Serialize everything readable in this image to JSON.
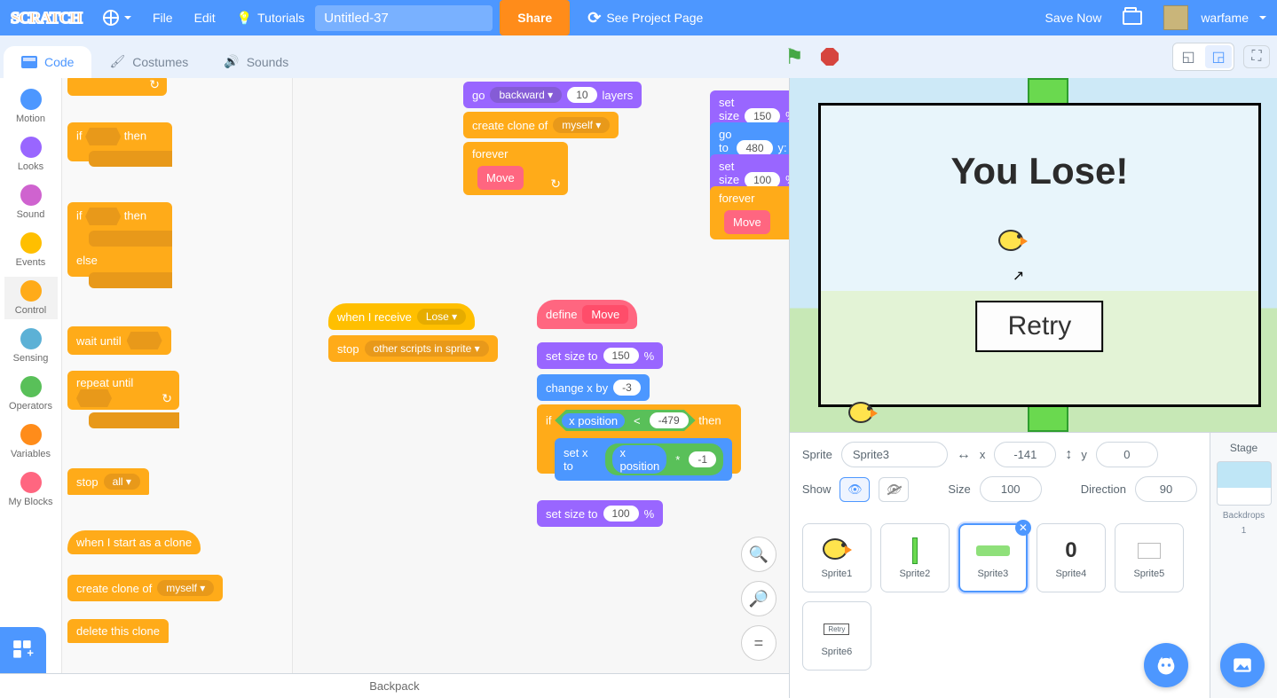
{
  "menubar": {
    "logo_text": "SCRATCH",
    "file": "File",
    "edit": "Edit",
    "tutorials": "Tutorials",
    "project_title": "Untitled-37",
    "share": "Share",
    "see_project": "See Project Page",
    "save_now": "Save Now",
    "username": "warfame"
  },
  "tabs": {
    "code": "Code",
    "costumes": "Costumes",
    "sounds": "Sounds"
  },
  "categories": [
    {
      "name": "Motion",
      "color": "#4c97ff"
    },
    {
      "name": "Looks",
      "color": "#9966ff"
    },
    {
      "name": "Sound",
      "color": "#cf63cf"
    },
    {
      "name": "Events",
      "color": "#ffbf00"
    },
    {
      "name": "Control",
      "color": "#ffab19"
    },
    {
      "name": "Sensing",
      "color": "#5cb1d6"
    },
    {
      "name": "Operators",
      "color": "#59c059"
    },
    {
      "name": "Variables",
      "color": "#ff8c1a"
    },
    {
      "name": "My Blocks",
      "color": "#ff6680"
    }
  ],
  "palette_blocks": {
    "if_then": "if            then",
    "else": "else",
    "wait_until": "wait until",
    "repeat_until": "repeat until",
    "stop": "stop",
    "stop_opt": "all ▾",
    "clone_start": "when I start as a clone",
    "create_clone": "create clone of",
    "create_clone_opt": "myself ▾",
    "delete_clone": "delete this clone"
  },
  "canvas_blocks": {
    "go_layers": {
      "go": "go",
      "dir": "backward ▾",
      "n": "10",
      "layers": "layers"
    },
    "create_clone": {
      "label": "create clone of",
      "opt": "myself ▾"
    },
    "forever": "forever",
    "move": "Move",
    "when_receive": {
      "label": "when I receive",
      "opt": "Lose ▾"
    },
    "stop_scripts": {
      "label": "stop",
      "opt": "other scripts in sprite ▾"
    },
    "define": "define",
    "set_size_150": {
      "label": "set size to",
      "val": "150",
      "pct": "%"
    },
    "change_x": {
      "label": "change x by",
      "val": "-3"
    },
    "if_then": "if",
    "then": "then",
    "xpos": "x position",
    "lt": "<",
    "cmp": "-479",
    "set_x": {
      "label": "set x to"
    },
    "times": "*",
    "neg1": "-1",
    "set_size_100": {
      "label": "set size to",
      "val": "100",
      "pct": "%"
    },
    "right_stack": {
      "set_size150": {
        "label": "set size to",
        "val": "150",
        "pct": "%"
      },
      "gotoxy": {
        "label": "go to x:",
        "x": "480",
        "y": "y:"
      },
      "set_size100": {
        "label": "set size to",
        "val": "100",
        "pct": "%"
      },
      "forever": "forever",
      "move": "Move"
    }
  },
  "zoom": {
    "in": "+",
    "out": "−",
    "eq": "="
  },
  "backpack": "Backpack",
  "stage": {
    "lose": "You Lose!",
    "retry": "Retry"
  },
  "sprite_info": {
    "sprite_label": "Sprite",
    "sprite_name": "Sprite3",
    "x_label": "x",
    "x": "-141",
    "y_label": "y",
    "y": "0",
    "show_label": "Show",
    "size_label": "Size",
    "size": "100",
    "dir_label": "Direction",
    "dir": "90"
  },
  "sprites": [
    {
      "name": "Sprite1",
      "thumb": "bird"
    },
    {
      "name": "Sprite2",
      "thumb": "pipe"
    },
    {
      "name": "Sprite3",
      "thumb": "ground",
      "selected": true
    },
    {
      "name": "Sprite4",
      "thumb": "zero"
    },
    {
      "name": "Sprite5",
      "thumb": "blank"
    },
    {
      "name": "Sprite6",
      "thumb": "retry"
    }
  ],
  "sprite4_thumb": "0",
  "stage_panel": {
    "title": "Stage",
    "backdrops_label": "Backdrops",
    "backdrops_count": "1"
  }
}
